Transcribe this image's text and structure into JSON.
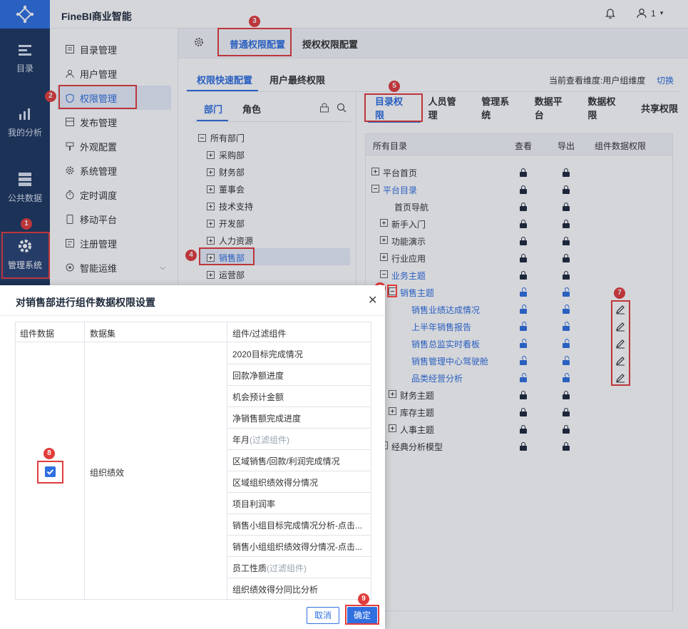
{
  "app": {
    "title": "FineBI商业智能",
    "user_label": "1"
  },
  "sidebar": {
    "items": [
      {
        "label": "目录"
      },
      {
        "label": "我的分析"
      },
      {
        "label": "公共数据"
      },
      {
        "label": "管理系统"
      }
    ]
  },
  "subnav": {
    "items": [
      {
        "label": "目录管理"
      },
      {
        "label": "用户管理"
      },
      {
        "label": "权限管理"
      },
      {
        "label": "发布管理"
      },
      {
        "label": "外观配置"
      },
      {
        "label": "系统管理"
      },
      {
        "label": "定时调度"
      },
      {
        "label": "移动平台"
      },
      {
        "label": "注册管理"
      },
      {
        "label": "智能运维"
      }
    ]
  },
  "top_tabs": {
    "normal": "普通权限配置",
    "grant": "授权权限配置"
  },
  "sub_tabs": {
    "quick": "权限快速配置",
    "final": "用户最终权限"
  },
  "view_dim": {
    "label": "当前查看维度:用户组维度",
    "switch": "切换"
  },
  "dept_tabs": {
    "dept": "部门",
    "role": "角色"
  },
  "dept_tree": {
    "root": "所有部门",
    "items": [
      "采购部",
      "财务部",
      "董事会",
      "技术支持",
      "开发部",
      "人力资源",
      "销售部",
      "运营部"
    ]
  },
  "perm_tabs": [
    "目录权限",
    "人员管理",
    "管理系统",
    "数据平台",
    "数据权限",
    "共享权限"
  ],
  "perm_table": {
    "headers": {
      "all": "所有目录",
      "view": "查看",
      "export": "导出",
      "component": "组件数据权限"
    },
    "rows": [
      {
        "label": "平台首页",
        "expander": "plus",
        "blue": false,
        "lock": "closed"
      },
      {
        "label": "平台目录",
        "expander": "minus",
        "blue": true,
        "lock": "closed"
      },
      {
        "label": "首页导航",
        "expander": "none",
        "blue": false,
        "lock": "closed"
      },
      {
        "label": "新手入门",
        "expander": "plus",
        "blue": false,
        "lock": "closed"
      },
      {
        "label": "功能演示",
        "expander": "plus",
        "blue": false,
        "lock": "closed"
      },
      {
        "label": "行业应用",
        "expander": "plus",
        "blue": false,
        "lock": "closed"
      },
      {
        "label": "业务主题",
        "expander": "minus",
        "blue": true,
        "lock": "closed"
      },
      {
        "label": "销售主题",
        "expander": "minus",
        "blue": true,
        "lock": "open"
      },
      {
        "label": "销售业绩达成情况",
        "expander": "none",
        "blue": true,
        "lock": "open",
        "edit": true
      },
      {
        "label": "上半年销售报告",
        "expander": "none",
        "blue": true,
        "lock": "open",
        "edit": true
      },
      {
        "label": "销售总监实时看板",
        "expander": "none",
        "blue": true,
        "lock": "open",
        "edit": true
      },
      {
        "label": "销售管理中心驾驶舱",
        "expander": "none",
        "blue": true,
        "lock": "open",
        "edit": true
      },
      {
        "label": "品类经营分析",
        "expander": "none",
        "blue": true,
        "lock": "open",
        "edit": true
      },
      {
        "label": "财务主题",
        "expander": "plus",
        "blue": false,
        "lock": "closed"
      },
      {
        "label": "库存主题",
        "expander": "plus",
        "blue": false,
        "lock": "closed"
      },
      {
        "label": "人事主题",
        "expander": "plus",
        "blue": false,
        "lock": "closed"
      },
      {
        "label": "经典分析模型",
        "expander": "plus",
        "blue": false,
        "lock": "closed"
      }
    ]
  },
  "dialog": {
    "title": "对销售部进行组件数据权限设置",
    "headers": {
      "data": "组件数据",
      "dataset": "数据集",
      "component": "组件/过滤组件"
    },
    "dataset": "组织绩效",
    "components": [
      {
        "name": "2020目标完成情况",
        "suffix": ""
      },
      {
        "name": "回款净额进度",
        "suffix": ""
      },
      {
        "name": "机会预计金额",
        "suffix": ""
      },
      {
        "name": "净销售额完成进度",
        "suffix": ""
      },
      {
        "name": "年月",
        "suffix": "(过滤组件)"
      },
      {
        "name": "区域销售/回款/利润完成情况",
        "suffix": ""
      },
      {
        "name": "区域组织绩效得分情况",
        "suffix": ""
      },
      {
        "name": "项目利润率",
        "suffix": ""
      },
      {
        "name": "销售小组目标完成情况分析-点击...",
        "suffix": ""
      },
      {
        "name": "销售小组组织绩效得分情况-点击...",
        "suffix": ""
      },
      {
        "name": "员工性质",
        "suffix": "(过滤组件)"
      },
      {
        "name": "组织绩效得分同比分析",
        "suffix": ""
      }
    ],
    "cancel": "取消",
    "ok": "确定"
  },
  "steps": [
    "1",
    "2",
    "3",
    "4",
    "5",
    "6",
    "7",
    "8",
    "9"
  ],
  "colors": {
    "sidebar": "#1e3760",
    "accent": "#2f6fe0",
    "mark": "#e13c3c"
  }
}
